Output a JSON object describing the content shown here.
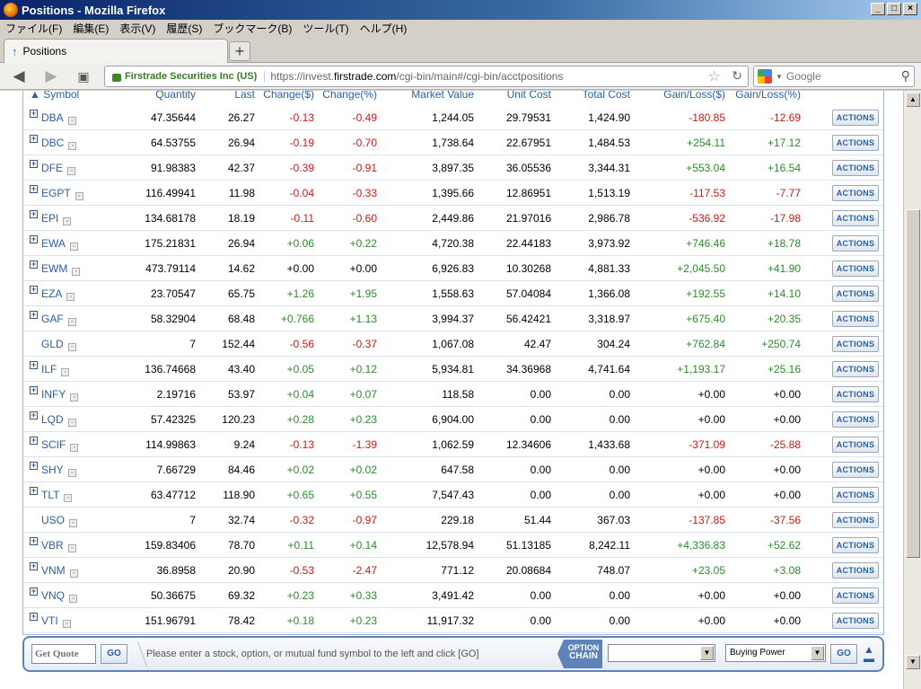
{
  "window": {
    "title": "Positions - Mozilla Firefox"
  },
  "menu": [
    "ファイル(F)",
    "編集(E)",
    "表示(V)",
    "履歴(S)",
    "ブックマーク(B)",
    "ツール(T)",
    "ヘルプ(H)"
  ],
  "tab": {
    "label": "Positions"
  },
  "nav": {
    "site_identity": "Firstrade Securities Inc (US)",
    "url_prefix": "https://invest.",
    "url_domain": "firstrade.com",
    "url_path": "/cgi-bin/main#/cgi-bin/acctpositions",
    "search_placeholder": "Google"
  },
  "table": {
    "headers": {
      "symbol": "▲ Symbol",
      "quantity": "Quantity",
      "last": "Last",
      "change": "Change($)",
      "change_pct": "Change(%)",
      "market_value": "Market Value",
      "unit_cost": "Unit Cost",
      "total_cost": "Total Cost",
      "gain_loss": "Gain/Loss($)",
      "gain_loss_pct": "Gain/Loss(%)"
    },
    "actions_label": "ACTIONS",
    "rows": [
      {
        "symbol": "DBA",
        "expand": true,
        "quantity": "47.35644",
        "last": "26.27",
        "change": "-0.13",
        "change_pct": "-0.49",
        "market_value": "1,244.05",
        "unit_cost": "29.79531",
        "total_cost": "1,424.90",
        "gain_loss": "-180.85",
        "gain_loss_pct": "-12.69"
      },
      {
        "symbol": "DBC",
        "expand": true,
        "quantity": "64.53755",
        "last": "26.94",
        "change": "-0.19",
        "change_pct": "-0.70",
        "market_value": "1,738.64",
        "unit_cost": "22.67951",
        "total_cost": "1,484.53",
        "gain_loss": "+254.11",
        "gain_loss_pct": "+17.12"
      },
      {
        "symbol": "DFE",
        "expand": true,
        "quantity": "91.98383",
        "last": "42.37",
        "change": "-0.39",
        "change_pct": "-0.91",
        "market_value": "3,897.35",
        "unit_cost": "36.05536",
        "total_cost": "3,344.31",
        "gain_loss": "+553.04",
        "gain_loss_pct": "+16.54"
      },
      {
        "symbol": "EGPT",
        "expand": true,
        "quantity": "116.49941",
        "last": "11.98",
        "change": "-0.04",
        "change_pct": "-0.33",
        "market_value": "1,395.66",
        "unit_cost": "12.86951",
        "total_cost": "1,513.19",
        "gain_loss": "-117.53",
        "gain_loss_pct": "-7.77"
      },
      {
        "symbol": "EPI",
        "expand": true,
        "quantity": "134.68178",
        "last": "18.19",
        "change": "-0.11",
        "change_pct": "-0.60",
        "market_value": "2,449.86",
        "unit_cost": "21.97016",
        "total_cost": "2,986.78",
        "gain_loss": "-536.92",
        "gain_loss_pct": "-17.98"
      },
      {
        "symbol": "EWA",
        "expand": true,
        "quantity": "175.21831",
        "last": "26.94",
        "change": "+0.06",
        "change_pct": "+0.22",
        "market_value": "4,720.38",
        "unit_cost": "22.44183",
        "total_cost": "3,973.92",
        "gain_loss": "+746.46",
        "gain_loss_pct": "+18.78"
      },
      {
        "symbol": "EWM",
        "expand": true,
        "quantity": "473.79114",
        "last": "14.62",
        "change": "+0.00",
        "change_pct": "+0.00",
        "market_value": "6,926.83",
        "unit_cost": "10.30268",
        "total_cost": "4,881.33",
        "gain_loss": "+2,045.50",
        "gain_loss_pct": "+41.90"
      },
      {
        "symbol": "EZA",
        "expand": true,
        "quantity": "23.70547",
        "last": "65.75",
        "change": "+1.26",
        "change_pct": "+1.95",
        "market_value": "1,558.63",
        "unit_cost": "57.04084",
        "total_cost": "1,366.08",
        "gain_loss": "+192.55",
        "gain_loss_pct": "+14.10"
      },
      {
        "symbol": "GAF",
        "expand": true,
        "quantity": "58.32904",
        "last": "68.48",
        "change": "+0.766",
        "change_pct": "+1.13",
        "market_value": "3,994.37",
        "unit_cost": "56.42421",
        "total_cost": "3,318.97",
        "gain_loss": "+675.40",
        "gain_loss_pct": "+20.35"
      },
      {
        "symbol": "GLD",
        "expand": false,
        "quantity": "7",
        "last": "152.44",
        "change": "-0.56",
        "change_pct": "-0.37",
        "market_value": "1,067.08",
        "unit_cost": "42.47",
        "total_cost": "304.24",
        "gain_loss": "+762.84",
        "gain_loss_pct": "+250.74"
      },
      {
        "symbol": "ILF",
        "expand": true,
        "quantity": "136.74668",
        "last": "43.40",
        "change": "+0.05",
        "change_pct": "+0.12",
        "market_value": "5,934.81",
        "unit_cost": "34.36968",
        "total_cost": "4,741.64",
        "gain_loss": "+1,193.17",
        "gain_loss_pct": "+25.16"
      },
      {
        "symbol": "INFY",
        "expand": true,
        "quantity": "2.19716",
        "last": "53.97",
        "change": "+0.04",
        "change_pct": "+0.07",
        "market_value": "118.58",
        "unit_cost": "0.00",
        "total_cost": "0.00",
        "gain_loss": "+0.00",
        "gain_loss_pct": "+0.00"
      },
      {
        "symbol": "LQD",
        "expand": true,
        "quantity": "57.42325",
        "last": "120.23",
        "change": "+0.28",
        "change_pct": "+0.23",
        "market_value": "6,904.00",
        "unit_cost": "0.00",
        "total_cost": "0.00",
        "gain_loss": "+0.00",
        "gain_loss_pct": "+0.00"
      },
      {
        "symbol": "SCIF",
        "expand": true,
        "quantity": "114.99863",
        "last": "9.24",
        "change": "-0.13",
        "change_pct": "-1.39",
        "market_value": "1,062.59",
        "unit_cost": "12.34606",
        "total_cost": "1,433.68",
        "gain_loss": "-371.09",
        "gain_loss_pct": "-25.88"
      },
      {
        "symbol": "SHY",
        "expand": true,
        "quantity": "7.66729",
        "last": "84.46",
        "change": "+0.02",
        "change_pct": "+0.02",
        "market_value": "647.58",
        "unit_cost": "0.00",
        "total_cost": "0.00",
        "gain_loss": "+0.00",
        "gain_loss_pct": "+0.00"
      },
      {
        "symbol": "TLT",
        "expand": true,
        "quantity": "63.47712",
        "last": "118.90",
        "change": "+0.65",
        "change_pct": "+0.55",
        "market_value": "7,547.43",
        "unit_cost": "0.00",
        "total_cost": "0.00",
        "gain_loss": "+0.00",
        "gain_loss_pct": "+0.00"
      },
      {
        "symbol": "USO",
        "expand": false,
        "quantity": "7",
        "last": "32.74",
        "change": "-0.32",
        "change_pct": "-0.97",
        "market_value": "229.18",
        "unit_cost": "51.44",
        "total_cost": "367.03",
        "gain_loss": "-137.85",
        "gain_loss_pct": "-37.56"
      },
      {
        "symbol": "VBR",
        "expand": true,
        "quantity": "159.83406",
        "last": "78.70",
        "change": "+0.11",
        "change_pct": "+0.14",
        "market_value": "12,578.94",
        "unit_cost": "51.13185",
        "total_cost": "8,242.11",
        "gain_loss": "+4,336.83",
        "gain_loss_pct": "+52.62"
      },
      {
        "symbol": "VNM",
        "expand": true,
        "quantity": "36.8958",
        "last": "20.90",
        "change": "-0.53",
        "change_pct": "-2.47",
        "market_value": "771.12",
        "unit_cost": "20.08684",
        "total_cost": "748.07",
        "gain_loss": "+23.05",
        "gain_loss_pct": "+3.08"
      },
      {
        "symbol": "VNQ",
        "expand": true,
        "quantity": "50.36675",
        "last": "69.32",
        "change": "+0.23",
        "change_pct": "+0.33",
        "market_value": "3,491.42",
        "unit_cost": "0.00",
        "total_cost": "0.00",
        "gain_loss": "+0.00",
        "gain_loss_pct": "+0.00"
      },
      {
        "symbol": "VTI",
        "expand": true,
        "quantity": "151.96791",
        "last": "78.42",
        "change": "+0.18",
        "change_pct": "+0.23",
        "market_value": "11,917.32",
        "unit_cost": "0.00",
        "total_cost": "0.00",
        "gain_loss": "+0.00",
        "gain_loss_pct": "+0.00"
      }
    ]
  },
  "quotebar": {
    "input_placeholder": "Get Quote",
    "go_label": "GO",
    "message": "Please enter a stock, option, or mutual fund symbol to the left and click [GO]",
    "option_chain_line1": "OPTION",
    "option_chain_line2": "CHAIN",
    "buying_power_selected": "Buying Power",
    "go2_label": "GO"
  },
  "colors": {
    "positive": "#2e8b2e",
    "negative": "#d01818",
    "link": "#2a5ea8"
  }
}
